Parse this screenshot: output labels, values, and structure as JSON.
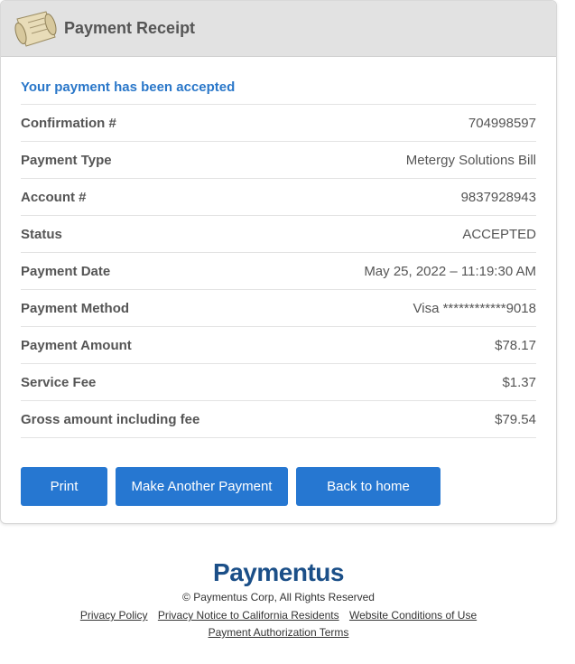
{
  "header": {
    "title": "Payment Receipt",
    "icon": "receipt-scroll-icon"
  },
  "status_message": "Your payment has been accepted",
  "rows": [
    {
      "label": "Confirmation #",
      "value": "704998597"
    },
    {
      "label": "Payment Type",
      "value": "Metergy Solutions Bill"
    },
    {
      "label": "Account #",
      "value": "9837928943"
    },
    {
      "label": "Status",
      "value": "ACCEPTED"
    },
    {
      "label": "Payment Date",
      "value": "May 25, 2022 – 11:19:30 AM"
    },
    {
      "label": "Payment Method",
      "value": "Visa ************9018"
    },
    {
      "label": "Payment Amount",
      "value": "$78.17"
    },
    {
      "label": "Service Fee",
      "value": "$1.37"
    },
    {
      "label": "Gross amount including fee",
      "value": "$79.54"
    }
  ],
  "buttons": {
    "print": "Print",
    "another": "Make Another Payment",
    "home": "Back to home"
  },
  "footer": {
    "brand": "Paymentus",
    "copyright": "© Paymentus Corp, All Rights Reserved",
    "links": [
      "Privacy Policy",
      "Privacy Notice to California Residents",
      "Website Conditions of Use",
      "Payment Authorization Terms"
    ]
  },
  "colors": {
    "accent": "#2677d1",
    "brand": "#1b4f88",
    "message": "#2a77c9"
  }
}
